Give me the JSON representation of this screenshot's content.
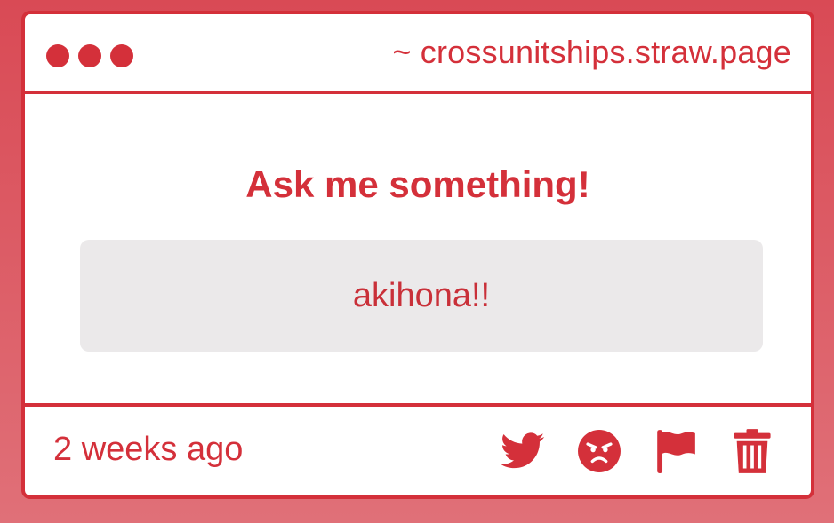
{
  "window": {
    "url": "~ crossunitships.straw.page"
  },
  "main": {
    "title": "Ask me something!",
    "answer": "akihona!!"
  },
  "footer": {
    "timestamp": "2 weeks ago",
    "actions": [
      "twitter-icon",
      "angry-face-icon",
      "flag-icon",
      "trash-icon"
    ]
  },
  "colors": {
    "accent": "#d4303a",
    "background": "#d94a55",
    "answer_box": "#ebe9ea"
  }
}
